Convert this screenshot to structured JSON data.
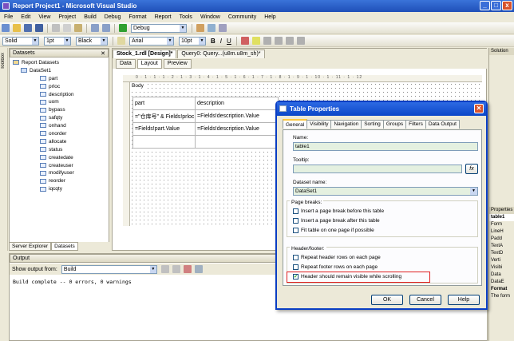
{
  "app": {
    "title": "Report Project1 - Microsoft Visual Studio",
    "window_buttons": [
      "_",
      "□",
      "x"
    ]
  },
  "menu": [
    "File",
    "Edit",
    "View",
    "Project",
    "Build",
    "Debug",
    "Format",
    "Report",
    "Tools",
    "Window",
    "Community",
    "Help"
  ],
  "toolbar1": {
    "config": "Debug"
  },
  "toolbar2": {
    "line_style": "Solid",
    "line_width": "1pt",
    "color": "Black",
    "font": "Arial",
    "font_size": "10pt",
    "bold": "B",
    "italic": "I",
    "underline": "U"
  },
  "datasets_panel": {
    "title": "Datasets",
    "root": "Report Datasets",
    "dataset": "DataSet1",
    "fields": [
      "part",
      "prloc",
      "description",
      "uom",
      "bypass",
      "safqty",
      "onhand",
      "onorder",
      "allocate",
      "status",
      "createdate",
      "createuser",
      "modifyuser",
      "reorder",
      "iqcqty"
    ],
    "bottom_tabs": [
      "Server Explorer",
      "Datasets"
    ]
  },
  "toolbox_label": "Toolbox",
  "document": {
    "tabs": [
      "Stock_1.rdl [Design]*",
      "Query0: Query...(u8m.u8m_sh)*"
    ],
    "subtabs": [
      "Data",
      "Layout",
      "Preview"
    ],
    "body_label": "Body",
    "ruler": "0 · 1 · 1 · 1 · 2 · 1 · 3 · 1 · 4 · 1 · 5 · 1 · 6 · 1 · 7 · 1 · 8 · 1 · 9 · 1 · 10 · 1 · 11 · 1 · 12",
    "table": [
      [
        "part",
        "description"
      ],
      [
        "=\"仓库号\" & Fields!prloc.Value & sum(Fields!",
        "=Fields!description.Value"
      ],
      [
        "=Fields!part.Value",
        "=Fields!description.Value"
      ]
    ]
  },
  "output": {
    "title": "Output",
    "show_label": "Show output from:",
    "source": "Build",
    "text": "Build complete -- 0 errors, 0 warnings"
  },
  "right_panel": {
    "solution": "Solution",
    "properties": "Properties",
    "object": "table1",
    "items": [
      "Form",
      "LineH",
      "Padd",
      "TextA",
      "TextD",
      "Verti",
      "Visibi",
      "Data",
      "DataE"
    ],
    "format_title": "Format",
    "format_desc": "The form"
  },
  "dialog": {
    "title": "Table Properties",
    "tabs": [
      "General",
      "Visibility",
      "Navigation",
      "Sorting",
      "Groups",
      "Filters",
      "Data Output"
    ],
    "name_label": "Name:",
    "name_value": "table1",
    "tooltip_label": "Tooltip:",
    "fx": "fx",
    "dataset_label": "Dataset name:",
    "dataset_value": "DataSet1",
    "page_breaks_label": "Page breaks:",
    "page_breaks": [
      {
        "label": "Insert a page break before this table",
        "checked": false
      },
      {
        "label": "Insert a page break after this table",
        "checked": false
      },
      {
        "label": "Fit table on one page if possible",
        "checked": false
      }
    ],
    "header_footer_label": "Header/footer:",
    "header_footer": [
      {
        "label": "Repeat header rows on each page",
        "checked": false
      },
      {
        "label": "Repeat footer rows on each page",
        "checked": false
      },
      {
        "label": "Header should remain visible while scrolling",
        "checked": true
      }
    ],
    "buttons": {
      "ok": "OK",
      "cancel": "Cancel",
      "help": "Help"
    }
  }
}
